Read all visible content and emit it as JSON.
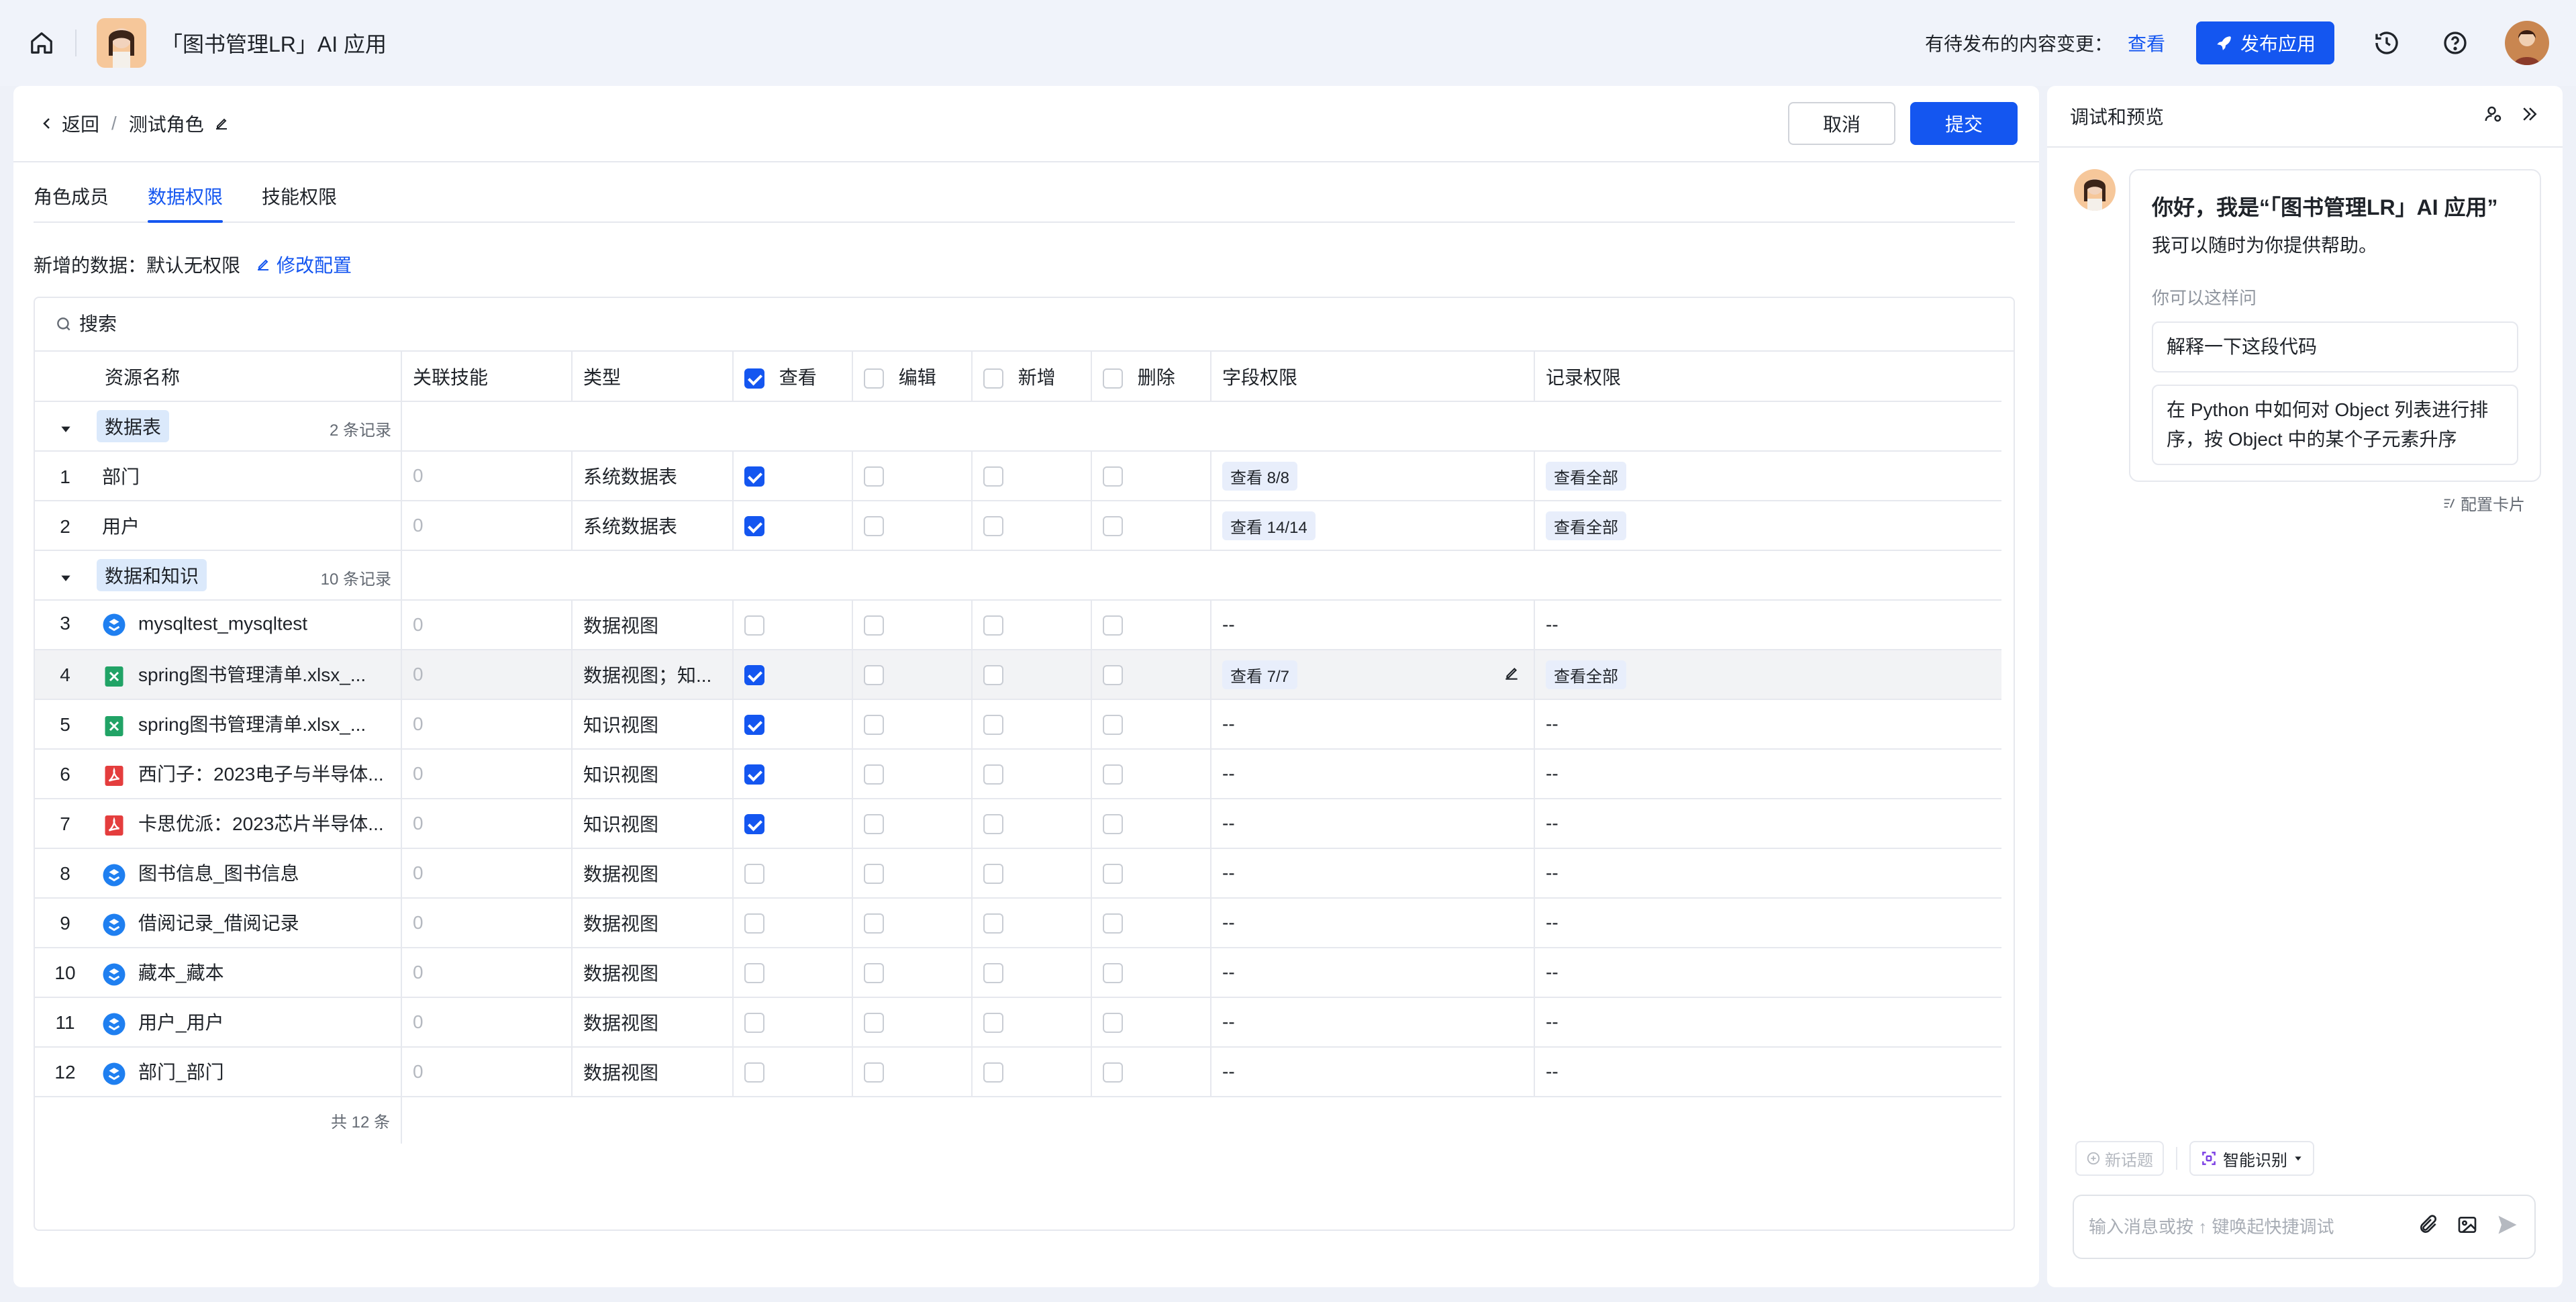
{
  "topbar": {
    "app_title": "「图书管理LR」AI 应用",
    "pending_text": "有待发布的内容变更：",
    "pending_link": "查看",
    "publish_label": "发布应用"
  },
  "header": {
    "back_label": "返回",
    "separator": "/",
    "role_title": "测试角色",
    "cancel_label": "取消",
    "submit_label": "提交"
  },
  "tabs": [
    "角色成员",
    "数据权限",
    "技能权限"
  ],
  "active_tab": 1,
  "new_data": {
    "label": "新增的数据：默认无权限",
    "modify_label": "修改配置"
  },
  "search": {
    "placeholder": "搜索"
  },
  "columns": {
    "name": "资源名称",
    "skill": "关联技能",
    "type": "类型",
    "view": "查看",
    "edit": "编辑",
    "add": "新增",
    "delete": "删除",
    "field": "字段权限",
    "record": "记录权限"
  },
  "header_checks": {
    "view": true,
    "edit": false,
    "add": false,
    "delete": false
  },
  "groups": [
    {
      "name": "数据表",
      "count": "2 条记录",
      "rows": [
        {
          "idx": "1",
          "icon": "table-icon",
          "name": "部门",
          "skill": "0",
          "type": "系统数据表",
          "view": true,
          "field": "查看 8/8",
          "record": "查看全部"
        },
        {
          "idx": "2",
          "icon": "table-icon",
          "name": "用户",
          "skill": "0",
          "type": "系统数据表",
          "view": true,
          "field": "查看 14/14",
          "record": "查看全部"
        }
      ]
    },
    {
      "name": "数据和知识",
      "count": "10 条记录",
      "rows": [
        {
          "idx": "3",
          "icon": "dataview-icon",
          "name": "mysqltest_mysqltest",
          "skill": "0",
          "type": "数据视图",
          "view": false,
          "field": "--",
          "record": "--"
        },
        {
          "idx": "4",
          "icon": "excel-icon",
          "name": "spring图书管理清单.xlsx_...",
          "skill": "0",
          "type": "数据视图；知...",
          "view": true,
          "field": "查看 7/7",
          "record": "查看全部",
          "highlight": true
        },
        {
          "idx": "5",
          "icon": "excel-icon",
          "name": "spring图书管理清单.xlsx_...",
          "skill": "0",
          "type": "知识视图",
          "view": true,
          "field": "--",
          "record": "--"
        },
        {
          "idx": "6",
          "icon": "pdf-icon",
          "name": "西门子：2023电子与半导体...",
          "skill": "0",
          "type": "知识视图",
          "view": true,
          "field": "--",
          "record": "--"
        },
        {
          "idx": "7",
          "icon": "pdf-icon",
          "name": "卡思优派：2023芯片半导体...",
          "skill": "0",
          "type": "知识视图",
          "view": true,
          "field": "--",
          "record": "--"
        },
        {
          "idx": "8",
          "icon": "dataview-icon",
          "name": "图书信息_图书信息",
          "skill": "0",
          "type": "数据视图",
          "view": false,
          "field": "--",
          "record": "--"
        },
        {
          "idx": "9",
          "icon": "dataview-icon",
          "name": "借阅记录_借阅记录",
          "skill": "0",
          "type": "数据视图",
          "view": false,
          "field": "--",
          "record": "--"
        },
        {
          "idx": "10",
          "icon": "dataview-icon",
          "name": "藏本_藏本",
          "skill": "0",
          "type": "数据视图",
          "view": false,
          "field": "--",
          "record": "--"
        },
        {
          "idx": "11",
          "icon": "dataview-icon",
          "name": "用户_用户",
          "skill": "0",
          "type": "数据视图",
          "view": false,
          "field": "--",
          "record": "--"
        },
        {
          "idx": "12",
          "icon": "dataview-icon",
          "name": "部门_部门",
          "skill": "0",
          "type": "数据视图",
          "view": false,
          "field": "--",
          "record": "--"
        }
      ]
    }
  ],
  "footer": {
    "total": "共 12 条"
  },
  "side": {
    "title": "调试和预览",
    "welcome_title": "你好，我是“「图书管理LR」AI 应用”",
    "welcome_sub": "我可以随时为你提供帮助。",
    "ask_label": "你可以这样问",
    "suggestions": [
      "解释一下这段代码",
      "在 Python 中如何对 Object 列表进行排序，按 Object 中的某个子元素升序"
    ],
    "config_card": "配置卡片",
    "new_topic": "新话题",
    "smart_label": "智能识别",
    "input_placeholder": "输入消息或按 ↑ 键唤起快捷调试"
  },
  "colors": {
    "primary": "#1456f0",
    "excel": "#21a366",
    "pdf": "#e43d3d",
    "dataview": "#1f7ff0"
  }
}
